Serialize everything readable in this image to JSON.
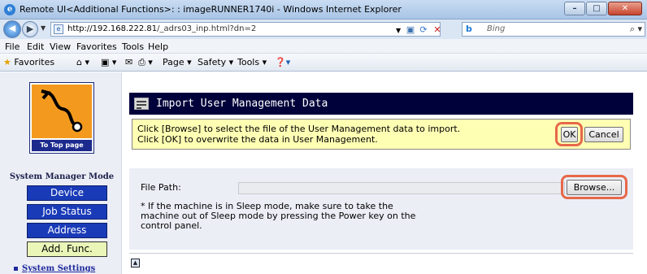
{
  "browser": {
    "window_title": "Remote UI<Additional Functions>: : imageRUNNER1740i - Windows Internet Explorer",
    "window_buttons": {
      "minimize": "–",
      "maximize": "□",
      "close": "✕"
    },
    "url_host": "http://192.168.222.81",
    "url_path": "/_adrs03_inp.html?dn=2",
    "search_engine": "Bing",
    "search_placeholder": "Bing",
    "menu": [
      "File",
      "Edit",
      "View",
      "Favorites",
      "Tools",
      "Help"
    ],
    "favorites_label": "Favorites",
    "command_bar": [
      "Page ▾",
      "Safety ▾",
      "Tools ▾"
    ]
  },
  "sidebar": {
    "top_page_label": "To Top page",
    "mode_title": "System Manager Mode",
    "buttons": [
      {
        "label": "Device",
        "active": false
      },
      {
        "label": "Job Status",
        "active": false
      },
      {
        "label": "Address",
        "active": false
      },
      {
        "label": "Add. Func.",
        "active": true
      }
    ],
    "link": "System Settings"
  },
  "panel": {
    "title": "Import User Management Data",
    "instructions": [
      "Click [Browse] to select the file of the User Management data to import.",
      "Click [OK] to overwrite the data in User Management."
    ],
    "ok_label": "OK",
    "cancel_label": "Cancel"
  },
  "form": {
    "file_path_label": "File Path:",
    "file_path_value": "",
    "browse_label": "Browse...",
    "note_lines": [
      "* If the machine is in Sleep mode, make sure to take the",
      "machine out of Sleep mode by pressing the Power key on the",
      "control panel."
    ]
  },
  "colors": {
    "header_navy": "#00003a",
    "message_yellow": "#ffffb4",
    "side_button_blue": "#1a3bb8",
    "active_button": "#eaf6b8",
    "highlight_ring": "#e6684a"
  }
}
